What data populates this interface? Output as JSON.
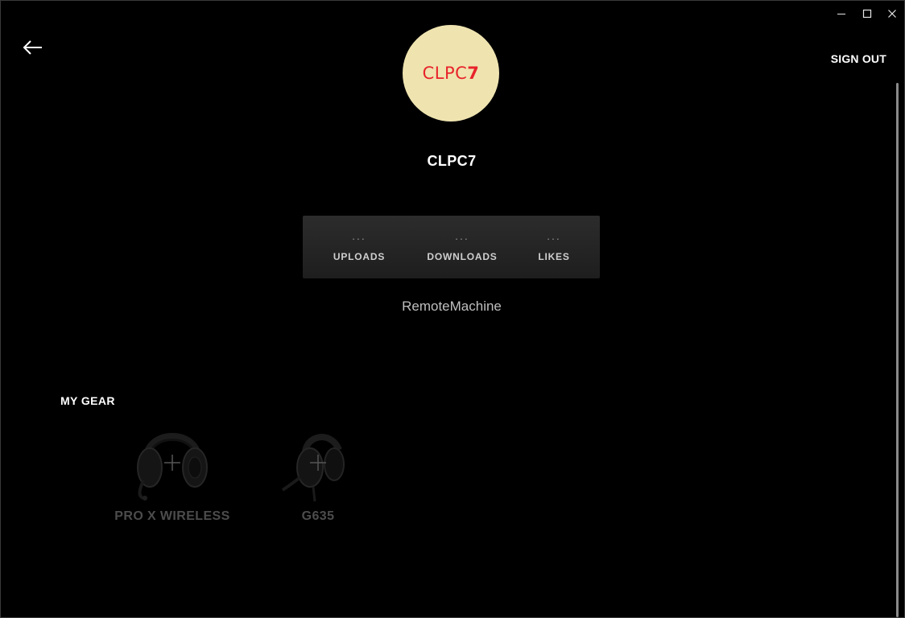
{
  "window": {
    "controls": {
      "minimize_icon": "minimize-icon",
      "maximize_icon": "maximize-icon",
      "close_icon": "close-icon"
    }
  },
  "header": {
    "back_icon": "arrow-left-icon",
    "sign_out_label": "SIGN OUT"
  },
  "profile": {
    "avatar_text_prefix": "CLPC",
    "avatar_text_suffix": "7",
    "avatar_bg": "#efe4b0",
    "avatar_text_color": "#e8242a",
    "username": "CLPC7",
    "machine_name": "RemoteMachine"
  },
  "stats": [
    {
      "value": "...",
      "label": "UPLOADS"
    },
    {
      "value": "...",
      "label": "DOWNLOADS"
    },
    {
      "value": "...",
      "label": "LIKES"
    }
  ],
  "gear": {
    "title": "MY GEAR",
    "items": [
      {
        "name": "PRO X WIRELESS",
        "icon": "headset-icon"
      },
      {
        "name": "G635",
        "icon": "headset-icon"
      }
    ]
  }
}
